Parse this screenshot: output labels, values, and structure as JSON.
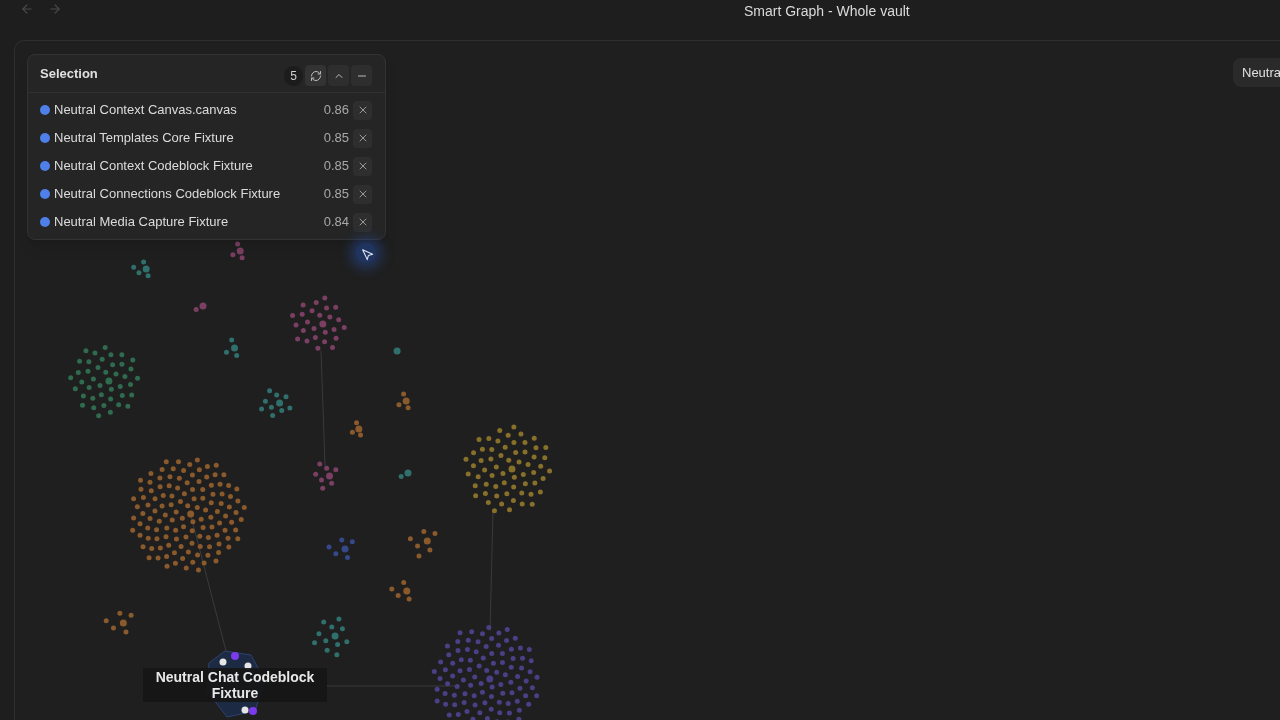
{
  "window": {
    "title": "Smart Graph - Whole vault"
  },
  "selection_panel": {
    "title": "Selection",
    "count": "5",
    "items": [
      {
        "name": "Neutral Context Canvas.canvas",
        "score": "0.86"
      },
      {
        "name": "Neutral Templates Core Fixture",
        "score": "0.85"
      },
      {
        "name": "Neutral Context Codeblock Fixture",
        "score": "0.85"
      },
      {
        "name": "Neutral Connections Codeblock Fixture",
        "score": "0.85"
      },
      {
        "name": "Neutral Media Capture Fixture",
        "score": "0.84"
      }
    ]
  },
  "hover_tooltip": "Neutra",
  "node_label": "Neutral Chat Codeblock Fixture"
}
